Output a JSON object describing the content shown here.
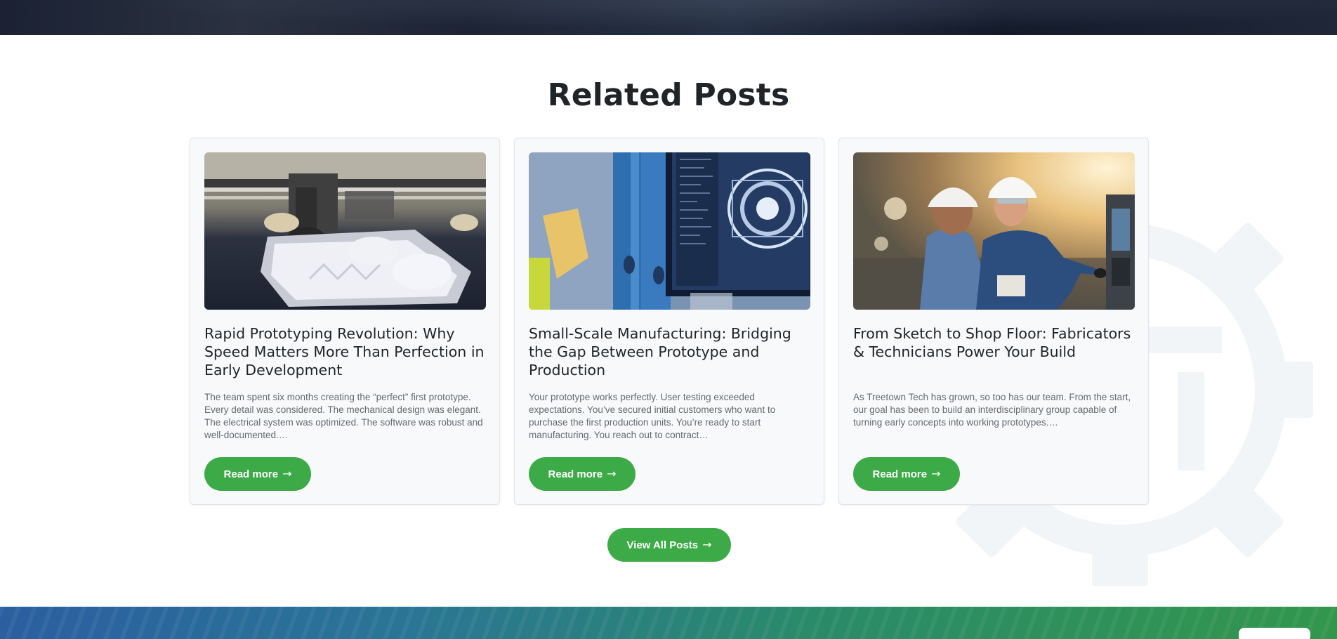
{
  "section": {
    "title": "Related Posts"
  },
  "posts": [
    {
      "title": "Rapid Prototyping Revolution: Why Speed Matters More Than Perfection in Early Development",
      "excerpt": "The team spent six months creating the “perfect” first prototype. Every detail was considered. The mechanical design was elegant. The electrical system was optimized. The software was robust and well-documented.…",
      "button_label": "Read more",
      "button_icon": "arrow-right-icon",
      "image": "3d-printer-image"
    },
    {
      "title": "Small-Scale Manufacturing: Bridging the Gap Between Prototype and Production",
      "excerpt": "Your prototype works perfectly. User testing exceeded expectations. You’ve secured initial customers who want to purchase the first production units. You’re ready to start manufacturing. You reach out to contract…",
      "button_label": "Read more",
      "button_icon": "arrow-right-icon",
      "image": "cad-monitor-image"
    },
    {
      "title": "From Sketch to Shop Floor: Fabricators & Technicians Power Your Build",
      "excerpt": "As Treetown Tech has grown, so too has our team. From the start, our goal has been to build an interdisciplinary group capable of turning early concepts into working prototypes.…",
      "button_label": "Read more",
      "button_icon": "arrow-right-icon",
      "image": "technicians-image"
    }
  ],
  "view_all": {
    "label": "View All Posts",
    "icon": "arrow-right-icon"
  },
  "colors": {
    "accent_green": "#3daa48",
    "heading": "#1f2428",
    "body_text": "#636a72",
    "card_bg": "#f8f9fb"
  }
}
